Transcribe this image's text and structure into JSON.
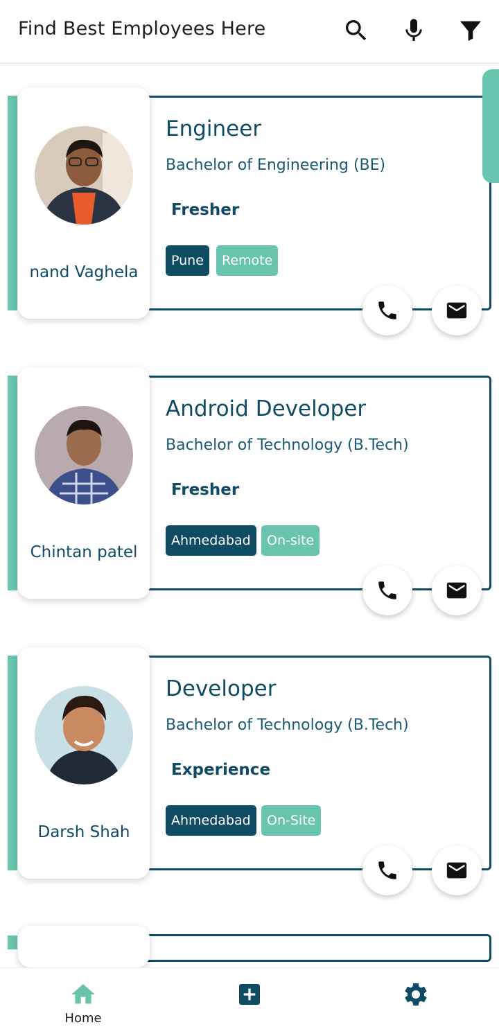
{
  "header": {
    "title": "Find Best Employees Here",
    "icons": [
      "search-icon",
      "microphone-icon",
      "filter-icon"
    ]
  },
  "colors": {
    "primary": "#0f4c64",
    "accent": "#69c4ae"
  },
  "employees": [
    {
      "name": "nand Vaghela",
      "job_title": "Engineer",
      "degree": "Bachelor of Engineering (BE)",
      "experience": "Fresher",
      "city": "Pune",
      "work_mode": "Remote"
    },
    {
      "name": "Chintan patel",
      "job_title": "Android Developer",
      "degree": "Bachelor of Technology (B.Tech)",
      "experience": "Fresher",
      "city": "Ahmedabad",
      "work_mode": "On-site"
    },
    {
      "name": "Darsh Shah",
      "job_title": "Developer",
      "degree": "Bachelor of Technology (B.Tech)",
      "experience": "Experience",
      "city": "Ahmedabad",
      "work_mode": "On-Site"
    }
  ],
  "bottom_nav": {
    "home_label": "Home",
    "icons": [
      "home-icon",
      "add-box-icon",
      "settings-icon"
    ]
  }
}
